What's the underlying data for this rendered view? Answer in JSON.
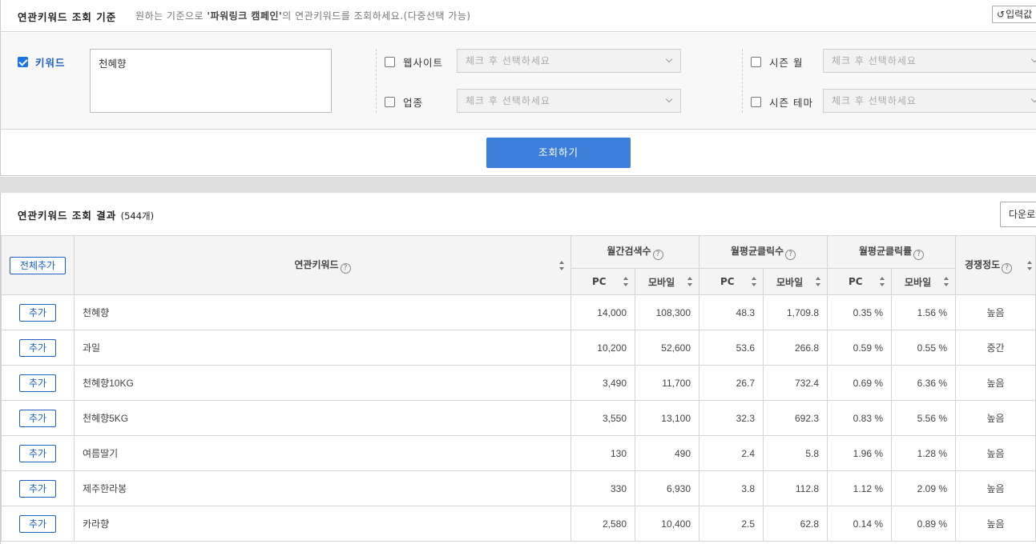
{
  "criteria": {
    "title": "연관키워드 조회 기준",
    "desc_prefix": "원하는 기준으로 ",
    "desc_bold": "'파워링크 캠페인'",
    "desc_suffix": "의 연관키워드를 조회하세요.(다중선택 가능)",
    "reset_label": "입력값",
    "keyword_label": "키워드",
    "keyword_value": "천혜향",
    "website_label": "웹사이트",
    "industry_label": "업종",
    "season_month_label": "시즌 월",
    "season_theme_label": "시즌 테마",
    "select_placeholder": "체크 후 선택하세요",
    "search_label": "조회하기"
  },
  "results": {
    "title": "연관키워드 조회 결과",
    "count": "(544개)",
    "download_label": "다운로드",
    "add_all_label": "전체추가",
    "add_label": "추가",
    "columns": {
      "keyword": "연관키워드",
      "monthly_search": "월간검색수",
      "monthly_clicks": "월평균클릭수",
      "monthly_ctr": "월평균클릭률",
      "competition": "경쟁정도",
      "pc": "PC",
      "mobile": "모바일"
    },
    "rows": [
      {
        "keyword": "천혜향",
        "search_pc": "14,000",
        "search_mobile": "108,300",
        "click_pc": "48.3",
        "click_mobile": "1,709.8",
        "ctr_pc": "0.35 %",
        "ctr_mobile": "1.56 %",
        "competition": "높음"
      },
      {
        "keyword": "과일",
        "search_pc": "10,200",
        "search_mobile": "52,600",
        "click_pc": "53.6",
        "click_mobile": "266.8",
        "ctr_pc": "0.59 %",
        "ctr_mobile": "0.55 %",
        "competition": "중간"
      },
      {
        "keyword": "천혜향10KG",
        "search_pc": "3,490",
        "search_mobile": "11,700",
        "click_pc": "26.7",
        "click_mobile": "732.4",
        "ctr_pc": "0.69 %",
        "ctr_mobile": "6.36 %",
        "competition": "높음"
      },
      {
        "keyword": "천혜향5KG",
        "search_pc": "3,550",
        "search_mobile": "13,100",
        "click_pc": "32.3",
        "click_mobile": "692.3",
        "ctr_pc": "0.83 %",
        "ctr_mobile": "5.56 %",
        "competition": "높음"
      },
      {
        "keyword": "여름딸기",
        "search_pc": "130",
        "search_mobile": "490",
        "click_pc": "2.4",
        "click_mobile": "5.8",
        "ctr_pc": "1.96 %",
        "ctr_mobile": "1.28 %",
        "competition": "높음"
      },
      {
        "keyword": "제주한라봉",
        "search_pc": "330",
        "search_mobile": "6,930",
        "click_pc": "3.8",
        "click_mobile": "112.8",
        "ctr_pc": "1.12 %",
        "ctr_mobile": "2.09 %",
        "competition": "높음"
      },
      {
        "keyword": "카라향",
        "search_pc": "2,580",
        "search_mobile": "10,400",
        "click_pc": "2.5",
        "click_mobile": "62.8",
        "ctr_pc": "0.14 %",
        "ctr_mobile": "0.89 %",
        "competition": "높음"
      }
    ]
  },
  "colors": {
    "accent": "#3c7fdb",
    "link": "#1f5ec7",
    "header_bg": "#f4f4f4",
    "divider_bg": "#dedede"
  },
  "icons": [
    "checkbox-checked-icon",
    "checkbox-icon",
    "chevron-down-icon",
    "question-icon",
    "sort-icon",
    "refresh-icon"
  ]
}
